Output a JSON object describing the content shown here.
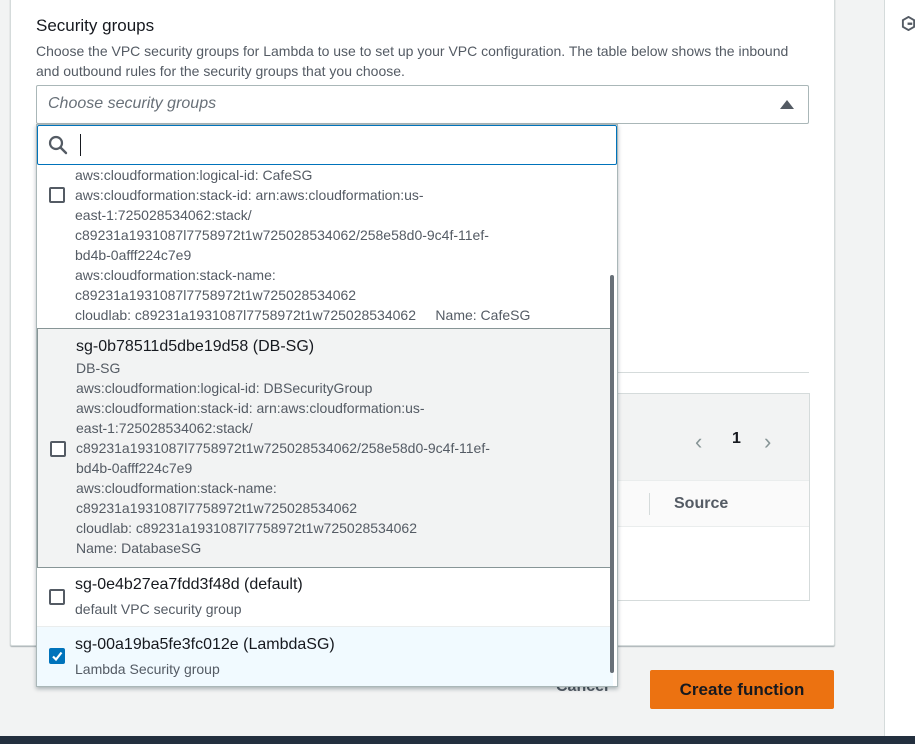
{
  "security_groups": {
    "title": "Security groups",
    "description": "Choose the VPC security groups for Lambda to use to set up your VPC configuration. The table below shows the inbound and outbound rules for the security groups that you choose.",
    "placeholder": "Choose security groups",
    "search_value": ""
  },
  "options": [
    {
      "name": "",
      "lines": [
        "aws:cloudformation:logical-id: CafeSG",
        "aws:cloudformation:stack-id: arn:aws:cloudformation:us-",
        "east-1:725028534062:stack/",
        "c89231a1931087l7758972t1w725028534062/258e58d0-9c4f-11ef-",
        "bd4b-0afff224c7e9",
        "aws:cloudformation:stack-name:",
        "c89231a1931087l7758972t1w725028534062",
        "cloudlab: c89231a1931087l7758972t1w725028534062     Name: CafeSG"
      ],
      "checked": false
    },
    {
      "name": "sg-0b78511d5dbe19d58 (DB-SG)",
      "lines": [
        "DB-SG",
        "aws:cloudformation:logical-id: DBSecurityGroup",
        "aws:cloudformation:stack-id: arn:aws:cloudformation:us-",
        "east-1:725028534062:stack/",
        "c89231a1931087l7758972t1w725028534062/258e58d0-9c4f-11ef-",
        "bd4b-0afff224c7e9",
        "aws:cloudformation:stack-name:",
        "c89231a1931087l7758972t1w725028534062",
        "cloudlab: c89231a1931087l7758972t1w725028534062",
        "Name: DatabaseSG"
      ],
      "checked": false
    },
    {
      "name": "sg-0e4b27ea7fdd3f48d (default)",
      "lines": [
        "default VPC security group"
      ],
      "checked": false
    },
    {
      "name": "sg-00a19ba5fe3fc012e (LambdaSG)",
      "lines": [
        "Lambda Security group"
      ],
      "checked": true
    }
  ],
  "rules_table": {
    "page": "1",
    "column_source": "Source",
    "icons": {
      "prev": "chevron-left-icon",
      "next": "chevron-right-icon"
    }
  },
  "footer": {
    "cancel_label": "Cancel",
    "create_label": "Create function"
  },
  "icons": {
    "search": "search-icon",
    "caret": "caret-up-icon",
    "side": "g-icon"
  },
  "colors": {
    "primary_button": "#ec7211",
    "focus_blue": "#0073bb",
    "nav_dark": "#232f3e"
  }
}
